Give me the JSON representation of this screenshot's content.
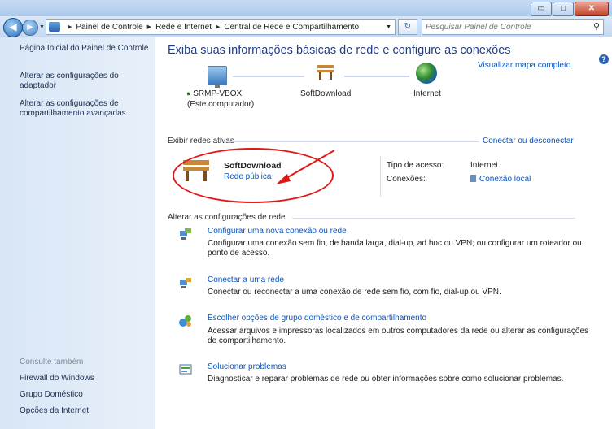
{
  "window": {
    "min_glyph": "▭",
    "max_glyph": "□",
    "close_glyph": "✕"
  },
  "breadcrumb": [
    "Painel de Controle",
    "Rede e Internet",
    "Central de Rede e Compartilhamento"
  ],
  "search": {
    "placeholder": "Pesquisar Painel de Controle"
  },
  "sidebar": {
    "links": [
      "Página Inicial do Painel de Controle",
      "Alterar as configurações do adaptador",
      "Alterar as configurações de compartilhamento avançadas"
    ],
    "see_also_title": "Consulte também",
    "see_also": [
      "Firewall do Windows",
      "Grupo Doméstico",
      "Opções da Internet"
    ]
  },
  "main": {
    "title": "Exiba suas informações básicas de rede e configure as conexões",
    "view_map": "Visualizar mapa completo",
    "nodes": {
      "computer": "SRMP-VBOX",
      "computer_sub": "(Este computador)",
      "network": "SoftDownload",
      "internet": "Internet"
    },
    "active_title": "Exibir redes ativas",
    "connect_disconnect": "Conectar ou desconectar",
    "active": {
      "name": "SoftDownload",
      "type": "Rede pública",
      "access_label": "Tipo de acesso:",
      "access_value": "Internet",
      "conn_label": "Conexões:",
      "conn_value": "Conexão local"
    },
    "change_title": "Alterar as configurações de rede",
    "tasks": [
      {
        "link": "Configurar uma nova conexão ou rede",
        "desc": "Configurar uma conexão sem fio, de banda larga, dial-up, ad hoc ou VPN; ou configurar um roteador ou ponto de acesso."
      },
      {
        "link": "Conectar a uma rede",
        "desc": "Conectar ou reconectar a uma conexão de rede sem fio, com fio, dial-up ou VPN."
      },
      {
        "link": "Escolher opções de grupo doméstico e de compartilhamento",
        "desc": "Acessar arquivos e impressoras localizados em outros computadores da rede ou alterar as configurações de compartilhamento."
      },
      {
        "link": "Solucionar problemas",
        "desc": "Diagnosticar e reparar problemas de rede ou obter informações sobre como solucionar problemas."
      }
    ]
  }
}
